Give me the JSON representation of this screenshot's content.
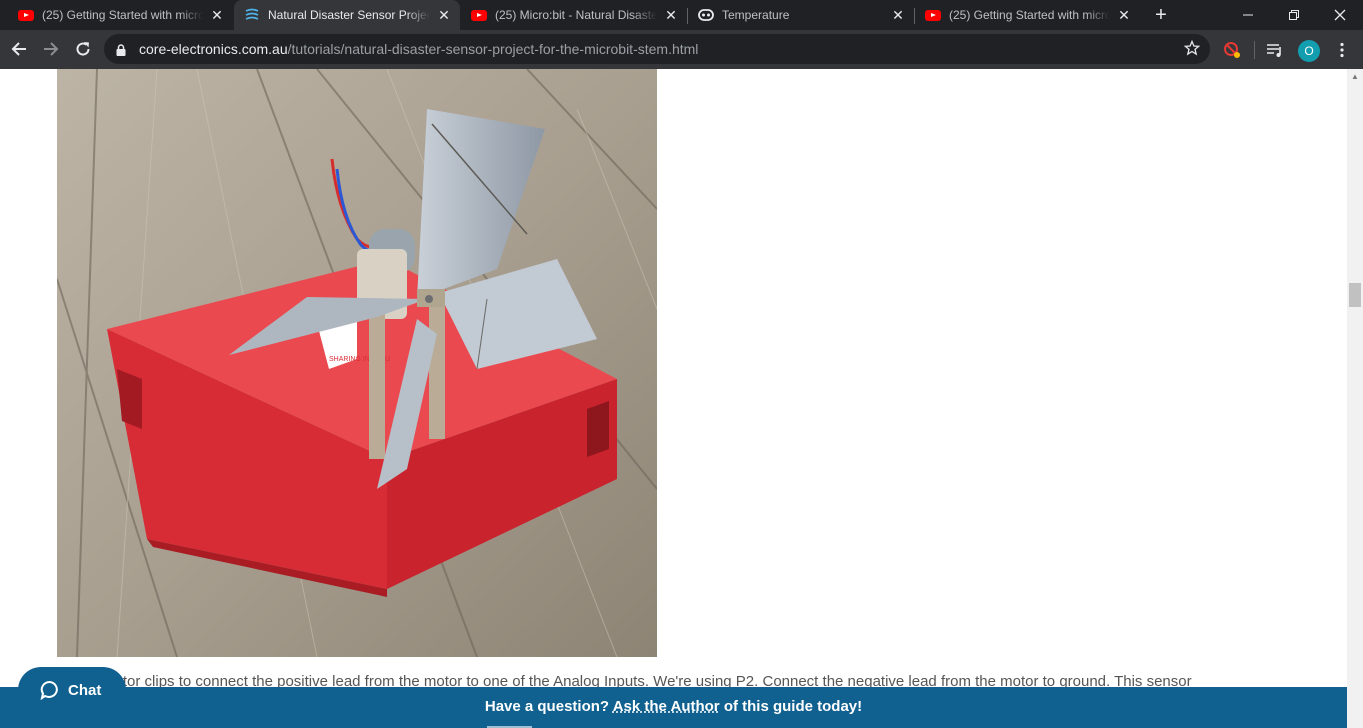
{
  "browser": {
    "tabs": [
      {
        "title": "(25) Getting Started with micro",
        "icon": "youtube-icon",
        "active": false
      },
      {
        "title": "Natural Disaster Sensor Project",
        "icon": "core-electronics-icon",
        "active": true
      },
      {
        "title": "(25) Micro:bit - Natural Disaste",
        "icon": "youtube-icon",
        "active": false
      },
      {
        "title": "Temperature",
        "icon": "microbit-icon",
        "active": false
      },
      {
        "title": "(25) Getting Started with micro",
        "icon": "youtube-icon",
        "active": false
      }
    ],
    "url_host": "core-electronics.com.au",
    "url_path": "/tutorials/natural-disaster-sensor-project-for-the-microbit-stem.html",
    "profile_initial": "O"
  },
  "article": {
    "image_alt": "Cardboard wind turbine with motor mounted on red box",
    "box_print": "SHARING INGENU",
    "paragraph": "Use alligator clips to connect the positive lead from the motor to one of the Analog Inputs. We're using P2. Connect the negative lead from the motor to ground. This sensor"
  },
  "banner": {
    "prefix": "Have a question?",
    "link": "Ask the Author",
    "suffix": "of this guide today!"
  },
  "chat": {
    "label": "Chat"
  },
  "colors": {
    "banner": "#106190",
    "tab_bg": "#202124",
    "toolbar_bg": "#35363a",
    "box_red": "#e0303a"
  }
}
